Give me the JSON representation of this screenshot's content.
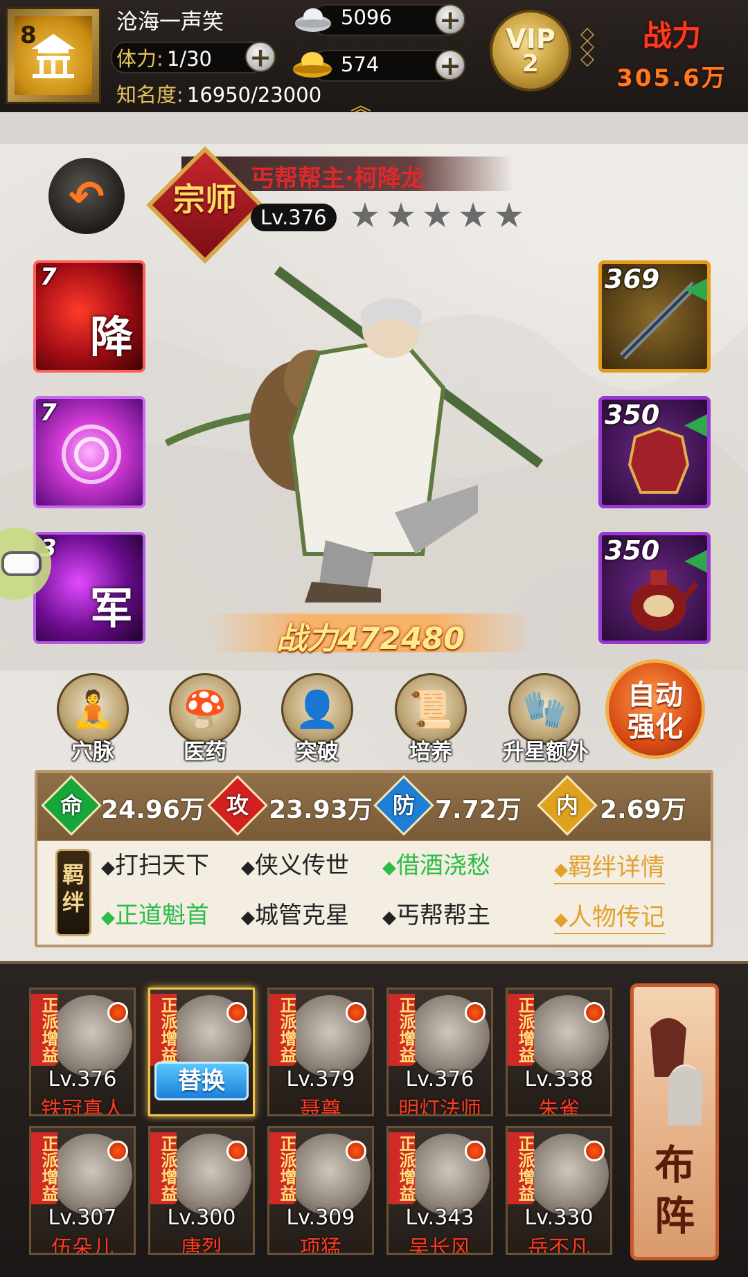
{
  "player": {
    "level": "8",
    "name": "沧海一声笑",
    "stamina_label": "体力:",
    "stamina_value": "1/30",
    "fame_label": "知名度:",
    "fame_value": "16950/23000",
    "silver": "5096",
    "gold": "574",
    "vip_text": "VIP",
    "vip_level": "2",
    "power_label": "战力",
    "power_value": "305.6万"
  },
  "hero": {
    "rank_badge": "宗师",
    "title": "丐帮帮主·柯降龙",
    "level": "Lv.376",
    "stars": 5,
    "stars_filled": 0,
    "combat_power": "战力472480"
  },
  "skills": [
    {
      "num": "7",
      "glyph": "降",
      "color": "#c1121c"
    },
    {
      "num": "7",
      "glyph": "",
      "color": "#b52bd6"
    },
    {
      "num": "3",
      "glyph": "军",
      "color": "#8e1fb0"
    }
  ],
  "equipment": [
    {
      "num": "369",
      "icon": "spear-icon",
      "frame": "#e39a1a"
    },
    {
      "num": "350",
      "icon": "armor-icon",
      "frame": "#9a36d2"
    },
    {
      "num": "350",
      "icon": "wine-pot-icon",
      "frame": "#9a36d2"
    }
  ],
  "actions": [
    {
      "label": "穴脉",
      "icon": "meridian-icon"
    },
    {
      "label": "医药",
      "icon": "medicine-icon"
    },
    {
      "label": "突破",
      "icon": "breakthrough-icon"
    },
    {
      "label": "培养",
      "icon": "cultivate-icon"
    },
    {
      "label": "升星额外",
      "icon": "star-up-icon"
    }
  ],
  "auto_enhance": [
    "自动",
    "强化"
  ],
  "stats": [
    {
      "icon": "命",
      "value": "24.96万",
      "color": "#16a63a"
    },
    {
      "icon": "攻",
      "value": "23.93万",
      "color": "#d2201f"
    },
    {
      "icon": "防",
      "value": "7.72万",
      "color": "#1f7fd6"
    },
    {
      "icon": "内",
      "value": "2.69万",
      "color": "#e0a11e"
    }
  ],
  "bond_tag": "羁绊",
  "bonds_row1": [
    {
      "text": "打扫天下",
      "active": false
    },
    {
      "text": "侠义传世",
      "active": false
    },
    {
      "text": "借酒浇愁",
      "active": true
    }
  ],
  "bonds_row2": [
    {
      "text": "正道魁首",
      "active": true
    },
    {
      "text": "城管克星",
      "active": false
    },
    {
      "text": "丐帮帮主",
      "active": false
    }
  ],
  "bond_links": [
    "羁绊详情",
    "人物传记"
  ],
  "team_tag": "正派增益",
  "swap_label": "替换",
  "team": [
    {
      "lv": "Lv.376",
      "name": "铁冠真人",
      "selected": false
    },
    {
      "lv": "",
      "name": "",
      "selected": true
    },
    {
      "lv": "Lv.379",
      "name": "聂尊",
      "selected": false
    },
    {
      "lv": "Lv.376",
      "name": "明灯法师",
      "selected": false
    },
    {
      "lv": "Lv.338",
      "name": "朱雀",
      "selected": false
    },
    {
      "lv": "Lv.307",
      "name": "伍朵儿",
      "selected": false
    },
    {
      "lv": "Lv.300",
      "name": "唐烈",
      "selected": false
    },
    {
      "lv": "Lv.309",
      "name": "项猛",
      "selected": false
    },
    {
      "lv": "Lv.343",
      "name": "吴长风",
      "selected": false
    },
    {
      "lv": "Lv.330",
      "name": "岳不凡",
      "selected": false
    }
  ],
  "formation_label": [
    "布",
    "阵"
  ]
}
